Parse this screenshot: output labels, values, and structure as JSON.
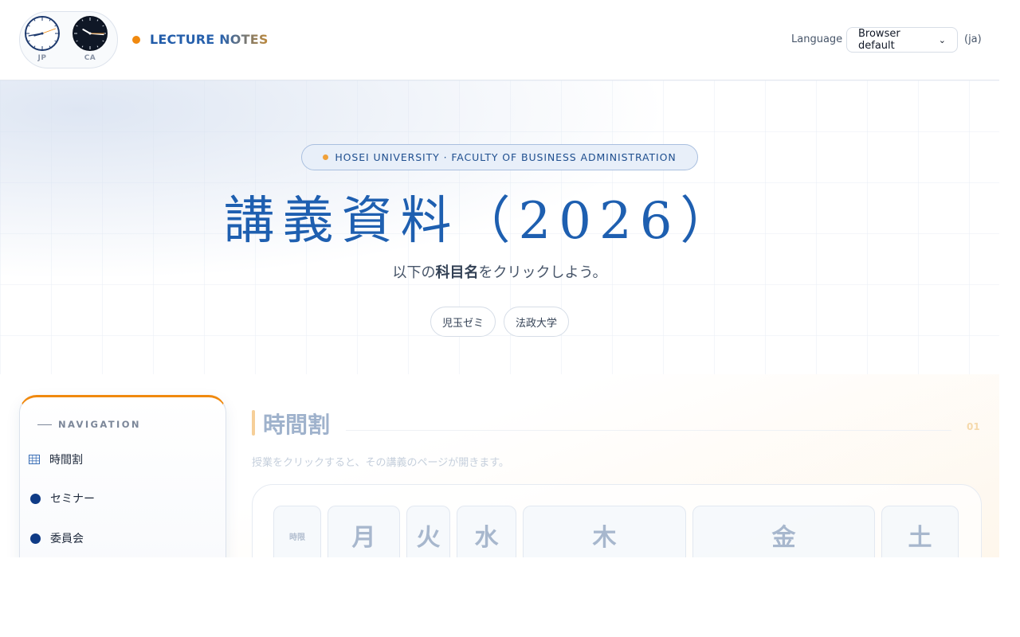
{
  "header": {
    "clocks": [
      {
        "label": "JP",
        "hour_deg": 255,
        "minute_deg": 260,
        "second_deg": 70,
        "theme": "light"
      },
      {
        "label": "CA",
        "hour_deg": 300,
        "minute_deg": 95,
        "second_deg": 90,
        "theme": "dark"
      }
    ],
    "brand": "LECTURE NOTES",
    "language_label": "Language",
    "language_selected": "Browser default",
    "language_code": "(ja)"
  },
  "hero": {
    "kicker": "HOSEI UNIVERSITY · FACULTY OF BUSINESS ADMINISTRATION",
    "title": "講義資料（2026）",
    "subtitle_pre": "以下の",
    "subtitle_bold": "科目名",
    "subtitle_post": "をクリックしよう。",
    "chips": [
      "児玉ゼミ",
      "法政大学"
    ]
  },
  "nav": {
    "heading": "NAVIGATION",
    "items": [
      {
        "label": "時間割",
        "icon": "grid-icon"
      },
      {
        "label": "セミナー",
        "icon": "dot-icon"
      },
      {
        "label": "委員会",
        "icon": "dot-icon"
      }
    ]
  },
  "section": {
    "title": "時間割",
    "number": "01",
    "description": "授業をクリックすると、その講義のページが開きます。"
  },
  "timetable": {
    "period_header": "時限",
    "days": [
      "月",
      "火",
      "水",
      "木",
      "金",
      "土"
    ]
  },
  "colors": {
    "accent_orange": "#f0890f",
    "brand_blue": "#1e5fb0",
    "navy": "#0f3b86"
  }
}
